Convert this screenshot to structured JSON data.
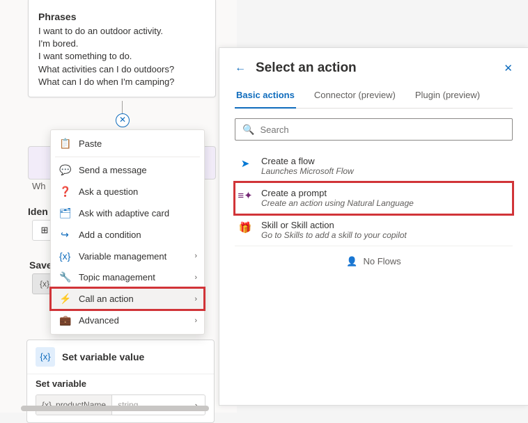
{
  "phrases": {
    "heading": "Phrases",
    "lines": [
      "I want to do an outdoor activity.",
      "I'm bored.",
      "I want something to do.",
      "What activities can I do outdoors?",
      "What can I do when I'm camping?"
    ]
  },
  "bg": {
    "wh": "Wh",
    "iden": "Iden",
    "save": "Save",
    "varx": "{x}",
    "grid_icon": "⊞"
  },
  "setvar": {
    "card_title": "Set variable value",
    "sub_label": "Set variable",
    "var_icon": "{x}",
    "var_name": "productName",
    "var_type": "string",
    "caret": "›"
  },
  "ctx": {
    "items": [
      {
        "icon": "📋",
        "label": "Paste",
        "chev": false
      },
      {
        "divider": true
      },
      {
        "icon": "💬",
        "label": "Send a message",
        "chev": false
      },
      {
        "icon": "❓",
        "label": "Ask a question",
        "chev": false
      },
      {
        "icon": "🗂",
        "label": "Ask with adaptive card",
        "chev": false
      },
      {
        "icon": "↪",
        "label": "Add a condition",
        "chev": false
      },
      {
        "icon": "{x}",
        "label": "Variable management",
        "chev": true
      },
      {
        "icon": "🔧",
        "label": "Topic management",
        "chev": true
      },
      {
        "icon": "⚡",
        "label": "Call an action",
        "chev": true,
        "hover": true,
        "highlight": true
      },
      {
        "icon": "💼",
        "label": "Advanced",
        "chev": true
      }
    ],
    "chev_glyph": "›"
  },
  "panel": {
    "title": "Select an action",
    "back": "←",
    "close": "✕",
    "tabs": [
      {
        "label": "Basic actions",
        "active": true
      },
      {
        "label": "Connector (preview)",
        "active": false
      },
      {
        "label": "Plugin (preview)",
        "active": false
      }
    ],
    "search_placeholder": "Search",
    "search_icon": "🔍",
    "actions": [
      {
        "title": "Create a flow",
        "sub": "Launches Microsoft Flow",
        "icon": "➤",
        "cls": "flow-ic",
        "highlight": false
      },
      {
        "title": "Create a prompt",
        "sub": "Create an action using Natural Language",
        "icon": "≡✦",
        "cls": "prompt-ic",
        "highlight": true
      },
      {
        "title": "Skill or Skill action",
        "sub": "Go to Skills to add a skill to your copilot",
        "icon": "🎁",
        "cls": "gift-ic",
        "highlight": false
      }
    ],
    "no_flows": "No Flows",
    "no_flows_icon": "👤"
  },
  "x_chip": "✕"
}
